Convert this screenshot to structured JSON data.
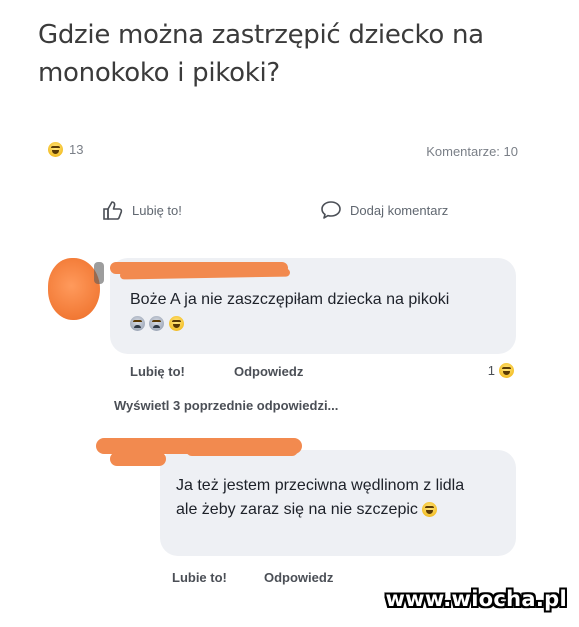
{
  "post": {
    "title": "Gdzie można zastrzępić dziecko na monokoko i pikoki?",
    "reaction_count": "13",
    "comments_label": "Komentarze: 10"
  },
  "actions": {
    "like_label": "Lubię to!",
    "comment_label": "Dodaj komentarz"
  },
  "comments": [
    {
      "text": "Boże A ja nie zaszczępiłam dziecka na pikoki",
      "like_label": "Lubię to!",
      "reply_label": "Odpowiedz",
      "reaction_count": "1"
    },
    {
      "text": "Ja też jestem przeciwna wędlinom z lidla ale żeby zaraz się na nie szczepic",
      "like_label": "Lubie to!",
      "reply_label": "Odpowiedz"
    }
  ],
  "view_previous_label": "Wyświetl 3 poprzednie odpowiedzi...",
  "watermark": "www.wiocha.pl",
  "colors": {
    "redaction": "#f28a4f",
    "bubble": "#eef0f4"
  }
}
